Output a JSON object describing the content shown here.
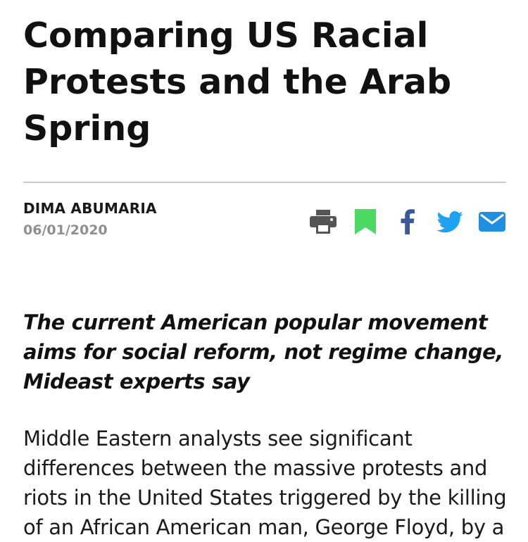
{
  "article": {
    "title": "Comparing US Racial Protests and the Arab Spring",
    "author": "DIMA ABUMARIA",
    "date": "06/01/2020",
    "subtitle": "The current American popular movement aims for social reform, not regime change, Mideast experts say",
    "body": "Middle Eastern analysts see significant differences between the massive protests and riots in the United States triggered by the killing of an African American man, George Floyd, by a"
  },
  "share": {
    "icons": [
      "print-icon",
      "bookmark-icon",
      "facebook-icon",
      "twitter-icon",
      "email-icon"
    ],
    "colors": {
      "print": "#555555",
      "bookmark": "#4cd964",
      "facebook": "#3b5998",
      "twitter": "#1da1f2",
      "email": "#1e8fe1"
    }
  }
}
